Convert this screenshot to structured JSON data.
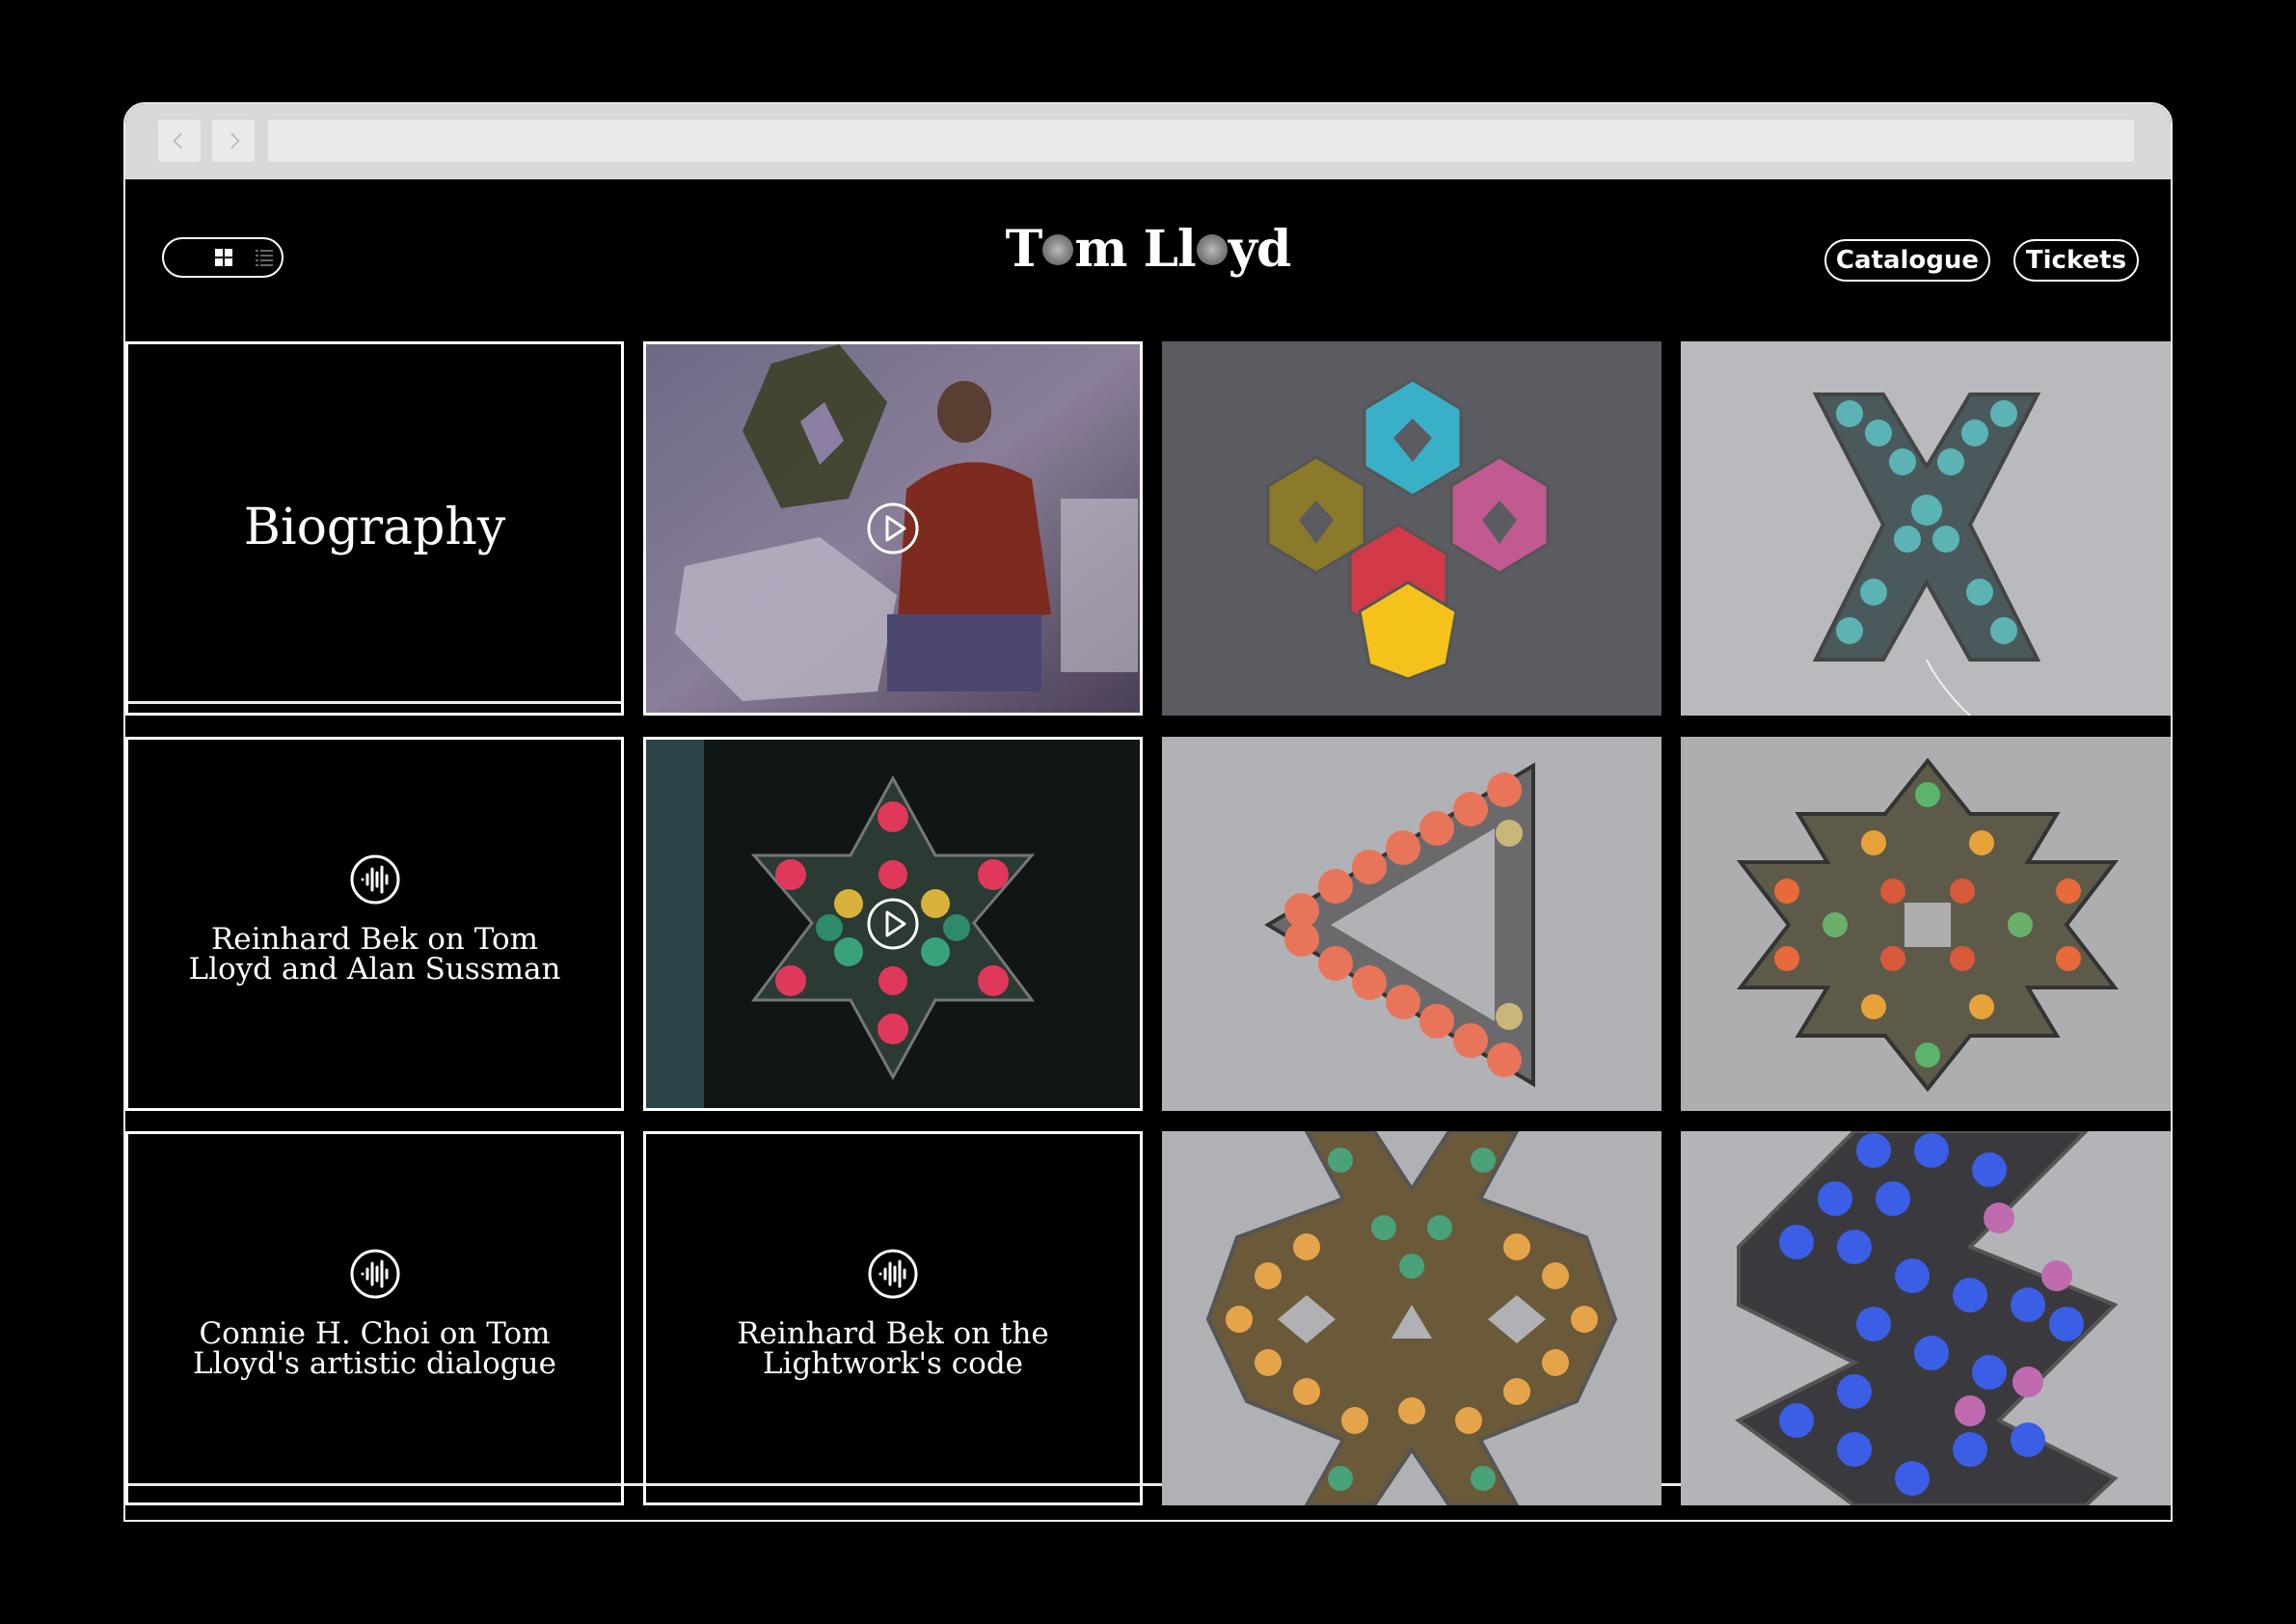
{
  "browser": {
    "back_icon": "chevron-left-icon",
    "forward_icon": "chevron-right-icon",
    "address": ""
  },
  "header": {
    "logo": {
      "part1": "T",
      "part2": "m Ll",
      "part3": "yd"
    },
    "view_toggle": {
      "active": "grid",
      "icons": [
        "grid-icon",
        "list-icon"
      ]
    },
    "nav": [
      {
        "label": "Catalogue"
      },
      {
        "label": "Tickets"
      }
    ]
  },
  "grid": {
    "biography": {
      "title": "Biography"
    },
    "audio": [
      {
        "title": "Reinhard Bek on Tom\nLloyd and Alan Sussman",
        "icon": "audio-wave-icon"
      },
      {
        "title": "Connie H. Choi on Tom\nLloyd's artistic dialogue",
        "icon": "audio-wave-icon"
      },
      {
        "title": "Reinhard Bek on the\nLightwork's code",
        "icon": "audio-wave-icon"
      }
    ],
    "videos": [
      {
        "icon": "play-icon"
      },
      {
        "icon": "play-icon"
      }
    ]
  },
  "colors": {
    "background": "#000000",
    "chrome": "#d7d8da",
    "text": "#ffffff"
  }
}
